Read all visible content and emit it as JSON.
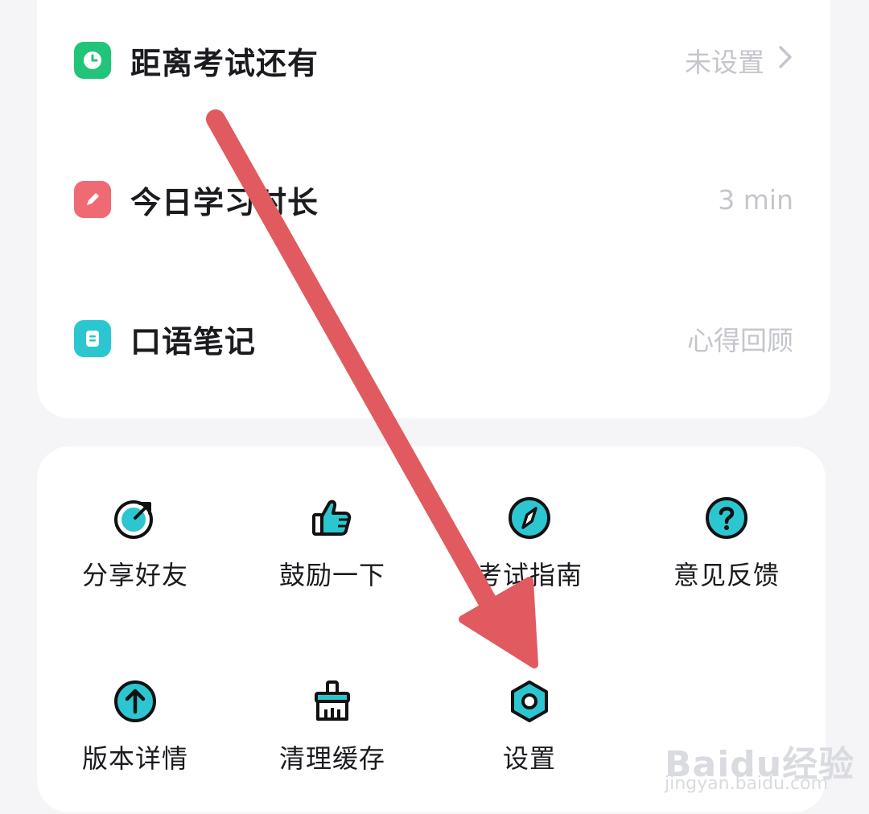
{
  "rows": [
    {
      "title": "距离考试还有",
      "value": "未设置",
      "icon": "clock-icon",
      "color": "#22c47a"
    },
    {
      "title": "今日学习时长",
      "value": "3 min",
      "icon": "pencil-icon",
      "color": "#f06a73"
    },
    {
      "title": "口语笔记",
      "value": "心得回顾",
      "icon": "note-icon",
      "color": "#2cc6d1"
    }
  ],
  "grid": [
    {
      "label": "分享好友",
      "icon": "share-icon"
    },
    {
      "label": "鼓励一下",
      "icon": "thumbs-up-icon"
    },
    {
      "label": "考试指南",
      "icon": "compass-icon"
    },
    {
      "label": "意见反馈",
      "icon": "help-icon"
    },
    {
      "label": "版本详情",
      "icon": "upgrade-icon"
    },
    {
      "label": "清理缓存",
      "icon": "broom-icon"
    },
    {
      "label": "设置",
      "icon": "settings-icon"
    }
  ],
  "watermark": {
    "logo": "Baidu经验",
    "url": "jingyan.baidu.com"
  },
  "colors": {
    "accent": "#2cc6d1",
    "arrow": "#e05a60"
  }
}
